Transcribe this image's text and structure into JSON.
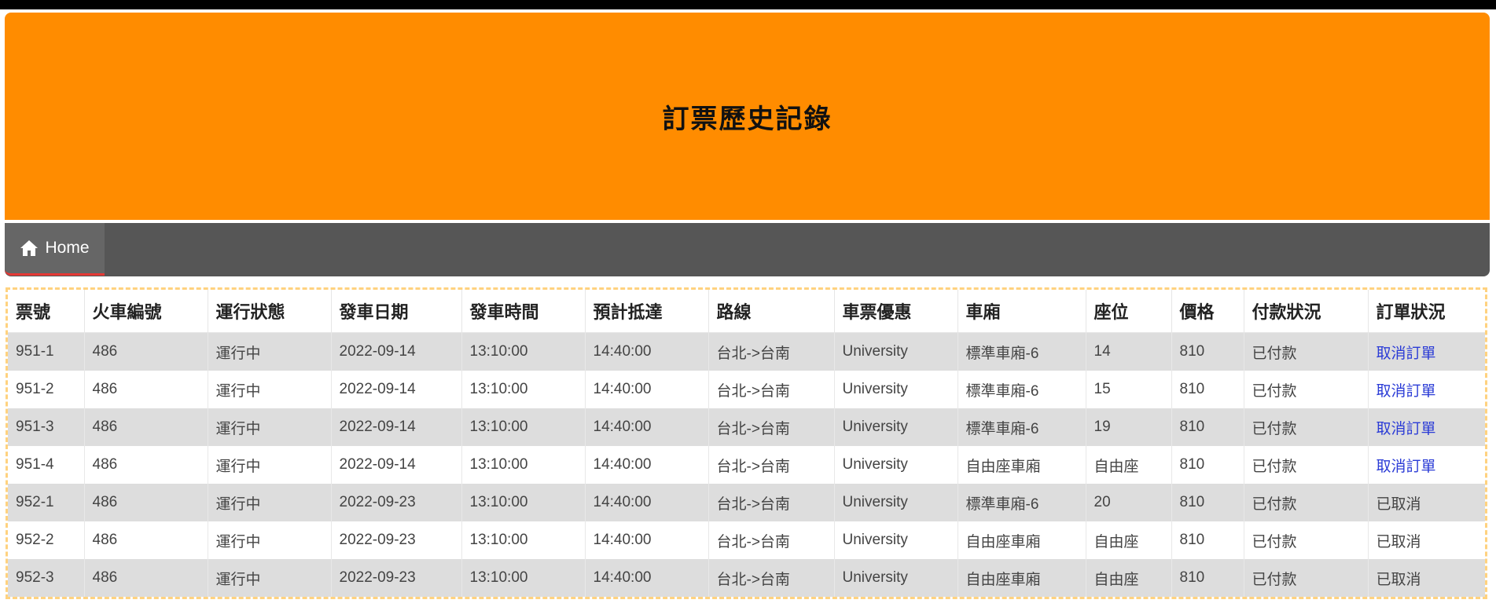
{
  "page": {
    "title": "訂票歷史記錄"
  },
  "nav": {
    "home_label": "Home",
    "home_icon": "home-icon"
  },
  "colors": {
    "banner": "#FF8C00",
    "navbar": "#565656",
    "nav_active_underline": "#e53935",
    "link": "#2a3bd6",
    "row_stripe": "#DDDDDD",
    "table_border": "#FFD27F"
  },
  "table": {
    "headers": [
      "票號",
      "火車編號",
      "運行狀態",
      "發車日期",
      "發車時間",
      "預計抵達",
      "路線",
      "車票優惠",
      "車廂",
      "座位",
      "價格",
      "付款狀況",
      "訂單狀況"
    ],
    "rows": [
      {
        "ticket": "951-1",
        "train": "486",
        "run_status": "運行中",
        "date": "2022-09-14",
        "depart": "13:10:00",
        "arrive": "14:40:00",
        "route": "台北->台南",
        "discount": "University",
        "car": "標準車廂-6",
        "seat": "14",
        "price": "810",
        "payment": "已付款",
        "order": "取消訂單",
        "order_is_link": true
      },
      {
        "ticket": "951-2",
        "train": "486",
        "run_status": "運行中",
        "date": "2022-09-14",
        "depart": "13:10:00",
        "arrive": "14:40:00",
        "route": "台北->台南",
        "discount": "University",
        "car": "標準車廂-6",
        "seat": "15",
        "price": "810",
        "payment": "已付款",
        "order": "取消訂單",
        "order_is_link": true
      },
      {
        "ticket": "951-3",
        "train": "486",
        "run_status": "運行中",
        "date": "2022-09-14",
        "depart": "13:10:00",
        "arrive": "14:40:00",
        "route": "台北->台南",
        "discount": "University",
        "car": "標準車廂-6",
        "seat": "19",
        "price": "810",
        "payment": "已付款",
        "order": "取消訂單",
        "order_is_link": true
      },
      {
        "ticket": "951-4",
        "train": "486",
        "run_status": "運行中",
        "date": "2022-09-14",
        "depart": "13:10:00",
        "arrive": "14:40:00",
        "route": "台北->台南",
        "discount": "University",
        "car": "自由座車廂",
        "seat": "自由座",
        "price": "810",
        "payment": "已付款",
        "order": "取消訂單",
        "order_is_link": true
      },
      {
        "ticket": "952-1",
        "train": "486",
        "run_status": "運行中",
        "date": "2022-09-23",
        "depart": "13:10:00",
        "arrive": "14:40:00",
        "route": "台北->台南",
        "discount": "University",
        "car": "標準車廂-6",
        "seat": "20",
        "price": "810",
        "payment": "已付款",
        "order": "已取消",
        "order_is_link": false
      },
      {
        "ticket": "952-2",
        "train": "486",
        "run_status": "運行中",
        "date": "2022-09-23",
        "depart": "13:10:00",
        "arrive": "14:40:00",
        "route": "台北->台南",
        "discount": "University",
        "car": "自由座車廂",
        "seat": "自由座",
        "price": "810",
        "payment": "已付款",
        "order": "已取消",
        "order_is_link": false
      },
      {
        "ticket": "952-3",
        "train": "486",
        "run_status": "運行中",
        "date": "2022-09-23",
        "depart": "13:10:00",
        "arrive": "14:40:00",
        "route": "台北->台南",
        "discount": "University",
        "car": "自由座車廂",
        "seat": "自由座",
        "price": "810",
        "payment": "已付款",
        "order": "已取消",
        "order_is_link": false
      }
    ]
  }
}
